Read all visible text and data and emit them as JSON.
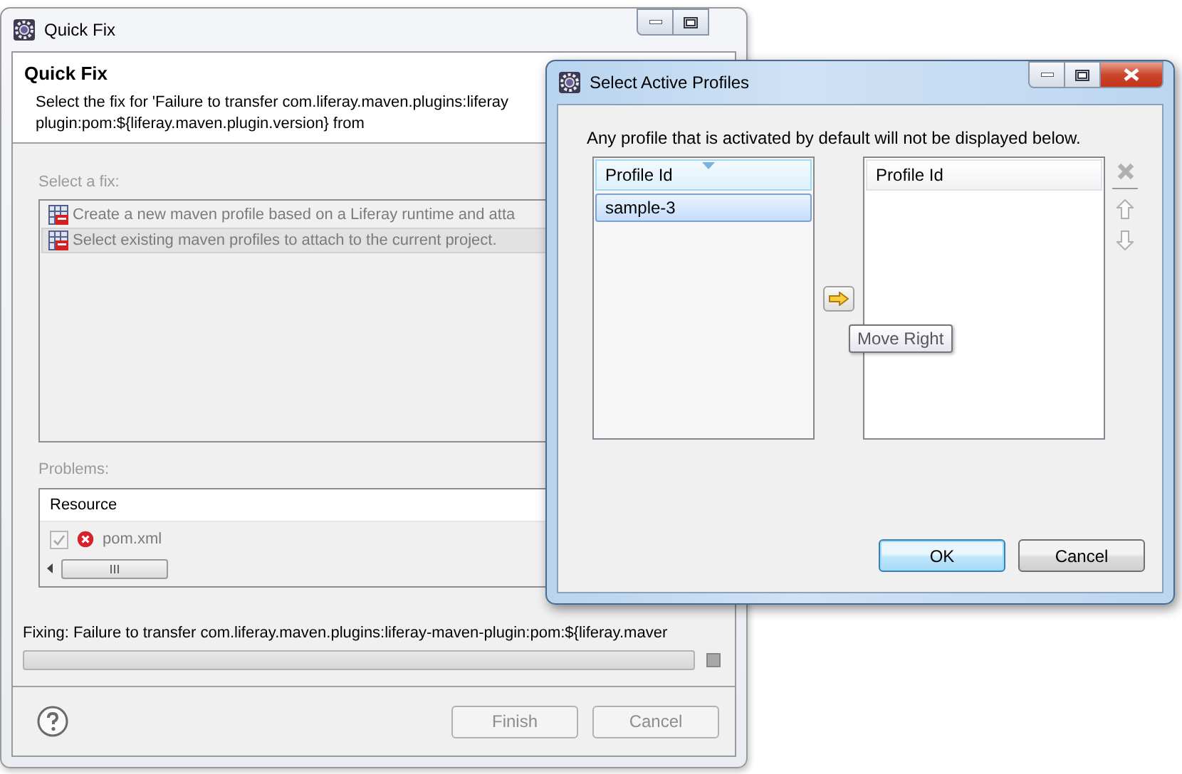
{
  "quick_fix_window": {
    "title": "Quick Fix",
    "heading": "Quick Fix",
    "description": [
      "Select the fix for 'Failure to transfer com.liferay.maven.plugins:liferay",
      "plugin:pom:${liferay.maven.plugin.version} from"
    ],
    "fix_label": "Select a fix:",
    "fixes": [
      {
        "label": "Create a new maven profile based on a Liferay runtime and atta",
        "selected": false
      },
      {
        "label": "Select existing maven profiles to attach to the current project.",
        "selected": true
      }
    ],
    "problems_label": "Problems:",
    "problems_table": {
      "columns": [
        "Resource"
      ],
      "rows": [
        {
          "checked": true,
          "resource": "pom.xml"
        }
      ]
    },
    "fixing_status": "Fixing: Failure to transfer com.liferay.maven.plugins:liferay-maven-plugin:pom:${liferay.maver",
    "progress": {
      "level": 0
    },
    "buttons": [
      {
        "label": "Finish",
        "disabled": true
      },
      {
        "label": "Cancel",
        "disabled": true
      }
    ]
  },
  "profiles_dialog": {
    "title": "Select Active Profiles",
    "message": "Any profile that is activated by default will not be displayed below.",
    "available_list": {
      "column": "Profile Id",
      "items": [
        {
          "label": "sample-3",
          "selected": true
        }
      ]
    },
    "tooltip": "Move Right",
    "active_list": {
      "column": "Profile Id"
    },
    "side_tools": [
      {
        "kind": "remove",
        "disabled": true
      },
      {
        "kind": "up",
        "disabled": true
      },
      {
        "kind": "down",
        "disabled": true
      }
    ],
    "buttons": [
      {
        "label": "OK",
        "default": true
      },
      {
        "label": "Cancel",
        "default": false
      }
    ]
  }
}
